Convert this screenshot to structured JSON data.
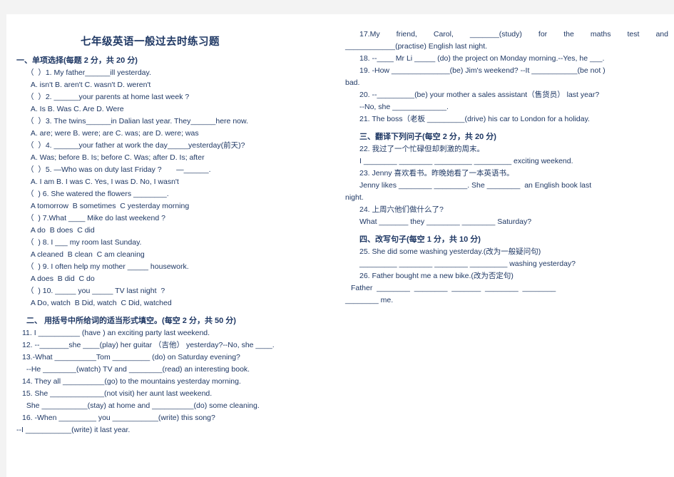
{
  "document": {
    "title": "七年级英语一般过去时练习题",
    "text_color": "#1f3864",
    "page_background": "#ffffff",
    "canvas_background": "#f3f3f3"
  },
  "left_column": {
    "section1_heading": "一、单项选择(每题 2 分，共 20 分)",
    "lines": [
      "（  ）1. My father______ill yesterday.",
      "  A. isn't B. aren't C. wasn't D. weren't",
      "（  ）2. ______your parents at home last week ?",
      "  A. Is B. Was C. Are D. Were",
      "（  ）3. The twins______in Dalian last year. They______here now.",
      "  A. are; were B. were; are C. was; are D. were; was",
      "（  ）4. ______your father at work the day_____yesterday(前天)?",
      "  A. Was; before B. Is; before C. Was; after D. Is; after",
      "（  ）5. —Who was on duty last Friday ?       —______.",
      "  A. I am B. I was C. Yes, I was D. No, I wasn't",
      "（  ) 6. She watered the flowers ________.",
      "  A tomorrow  B sometimes  C yesterday morning",
      "（  ) 7.What ____ Mike do last weekend ?",
      "  A do  B does  C did",
      "（  ) 8. I ___ my room last Sunday.",
      "  A cleaned  B clean  C am cleaning",
      "（  ) 9. I often help my mother _____ housework.",
      "  A does  B did  C do",
      "（  ) 10. _____ you _____ TV last night  ?",
      "  A Do, watch  B Did, watch  C Did, watched"
    ],
    "section2_heading": "二、 用括号中所给词的适当形式填空。(每空 2 分，共 50 分)",
    "fill_lines": [
      "11. I __________ (have ) an exciting party last weekend.",
      "12. --_______she ____(play) her guitar （吉他） yesterday?--No, she ____.",
      "13.-What __________Tom _________ (do) on Saturday evening?",
      "  --He ________(watch) TV and ________(read) an interesting book.",
      "14. They all __________(go) to the mountains yesterday morning.",
      "15. She _____________(not visit) her aunt last weekend.",
      "  She ___________(stay) at home and __________(do) some cleaning.",
      "16. -When _________ you ___________(write) this song?"
    ],
    "last_line": "--I ___________(write) it last year."
  },
  "right_column": {
    "q17_line1": "17.My    friend,    Carol,    _______(study)    for    the    maths    test    and",
    "q17_line2": "____________(practise) English last night.",
    "q18": "18. --____ Mr Li _____ (do) the project on Monday morning.--Yes, he ___.",
    "q19_line1": "19. -How ______________(be) Jim's weekend? --It ___________(be not )",
    "q19_line2": "bad.",
    "q20_line1": "20. --_________(be) your mother a sales assistant（售货员） last year?",
    "q20_line2": "--No, she _____________.",
    "q21": "21. The boss（老板 _________(drive) his car to London for a holiday.",
    "section3_heading": "三、翻译下列问子(每空 2 分，共 20 分)",
    "q22_cn": "22. 我过了一个忙碌但却刺激的周末。",
    "q22_en": "I ________ ________ _________ _________ exciting weekend.",
    "q23_cn": "23. Jenny 喜欢看书。昨晚她看了一本英语书。",
    "q23_en_line1": "Jenny likes ________ ________. She ________  an English book last",
    "q23_en_line2": "night.",
    "q24_cn": "24. 上周六他们做什么了?",
    "q24_en": "What _______ they ________ ________ Saturday?",
    "section4_heading": "四、改写句子(每空 1 分，共 10 分)",
    "q25_cn": "25. She did some washing yesterday.(改为一般疑问句)",
    "q25_en": "_________ ________ ________ _________ washing yesterday?",
    "q26_cn": "26. Father bought me a new bike.(改为否定句)",
    "q26_en_line1": "Father  ________  ________  _______  ________  ________",
    "q26_en_line2": "________ me."
  }
}
